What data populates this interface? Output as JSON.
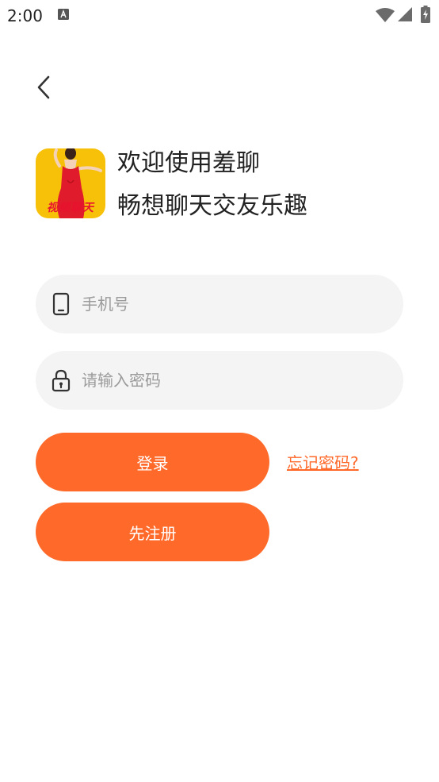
{
  "status_bar": {
    "time": "2:00"
  },
  "header": {
    "back_icon": "chevron-left-icon"
  },
  "logo": {
    "text": "视频聊天",
    "background": "#f7c10a",
    "text_color": "#e8122f"
  },
  "welcome": {
    "line1": "欢迎使用羞聊",
    "line2": "畅想聊天交友乐趣"
  },
  "form": {
    "phone_placeholder": "手机号",
    "phone_icon": "phone-icon",
    "password_placeholder": "请输入密码",
    "password_icon": "lock-icon",
    "login_label": "登录",
    "forgot_label": "忘记密码?",
    "register_label": "先注册"
  },
  "colors": {
    "accent": "#ff6a2b",
    "input_bg": "#f4f4f4"
  }
}
